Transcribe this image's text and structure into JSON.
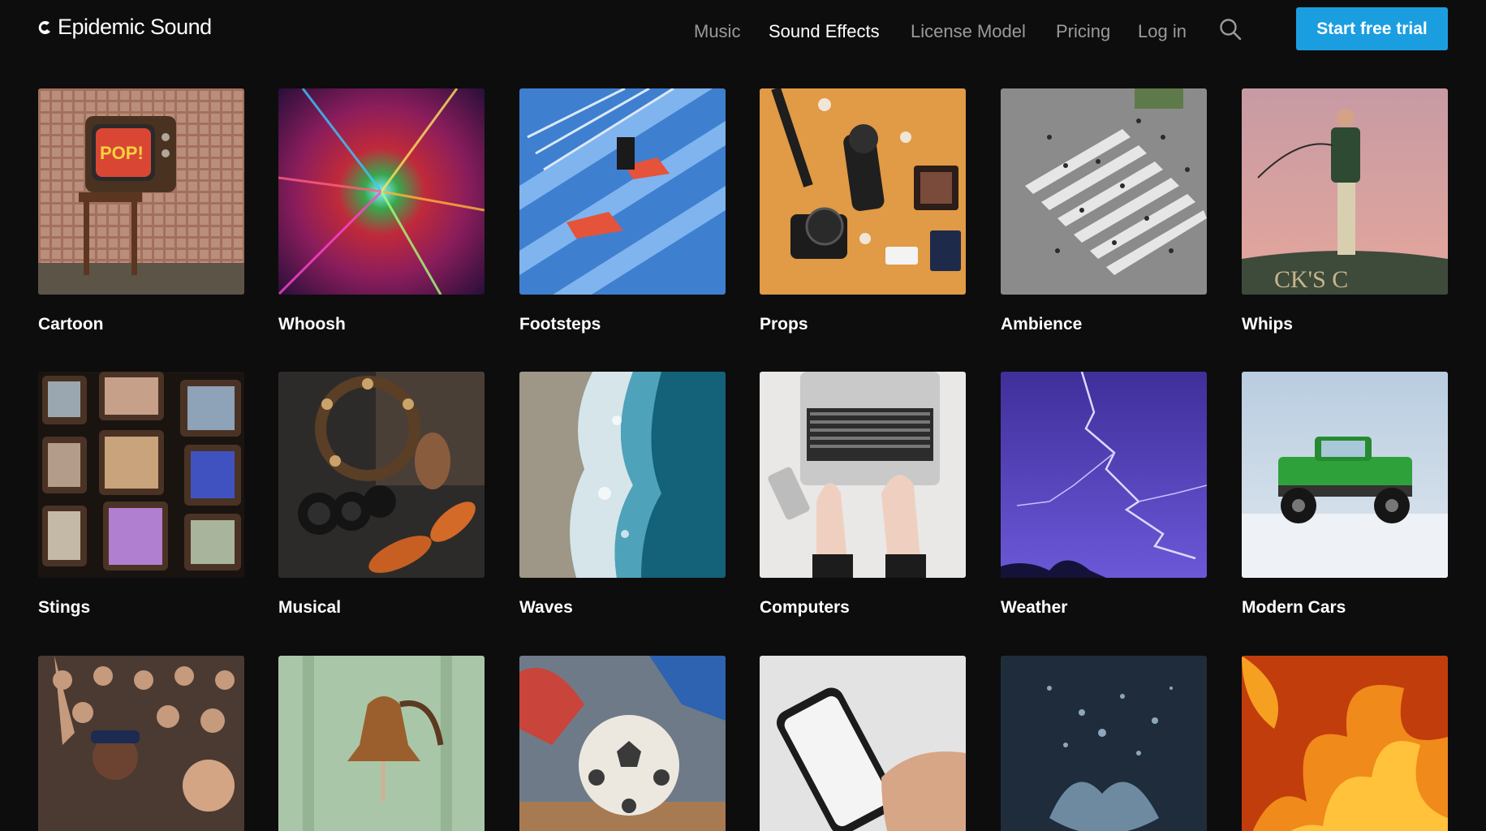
{
  "brand": {
    "name": "Epidemic Sound",
    "icon": "epidemic-logo-icon"
  },
  "nav": {
    "items": [
      {
        "label": "Music",
        "active": false
      },
      {
        "label": "Sound Effects",
        "active": true
      },
      {
        "label": "License Model",
        "active": false
      },
      {
        "label": "Pricing",
        "active": false
      },
      {
        "label": "Log in",
        "active": false
      }
    ],
    "search_icon": "search-icon",
    "cta_label": "Start free trial"
  },
  "colors": {
    "background": "#0d0d0d",
    "accent": "#1b9ee0",
    "nav_inactive": "#9a9a9a",
    "text": "#ffffff"
  },
  "categories": [
    {
      "label": "Cartoon",
      "image": "retro TV showing POP!"
    },
    {
      "label": "Whoosh",
      "image": "colorful light tunnel"
    },
    {
      "label": "Footsteps",
      "image": "sneakers on blue stairs"
    },
    {
      "label": "Props",
      "image": "camera and items on orange surface"
    },
    {
      "label": "Ambience",
      "image": "crowded crosswalk from above"
    },
    {
      "label": "Whips",
      "image": "man with whip on rooftop"
    },
    {
      "label": "Stings",
      "image": "stack of vintage TVs"
    },
    {
      "label": "Musical",
      "image": "tambourine, maracas and bongos"
    },
    {
      "label": "Waves",
      "image": "ocean waves on sand, aerial"
    },
    {
      "label": "Computers",
      "image": "hands typing on laptop"
    },
    {
      "label": "Weather",
      "image": "purple lightning sky"
    },
    {
      "label": "Modern Cars",
      "image": "green monster truck"
    },
    {
      "label": "",
      "image": "cheering crowd"
    },
    {
      "label": "",
      "image": "brass bell on wall"
    },
    {
      "label": "",
      "image": "soccer ball kick"
    },
    {
      "label": "",
      "image": "hand holding smartphone"
    },
    {
      "label": "",
      "image": "water splash in dark"
    },
    {
      "label": "",
      "image": "fire flames"
    }
  ]
}
